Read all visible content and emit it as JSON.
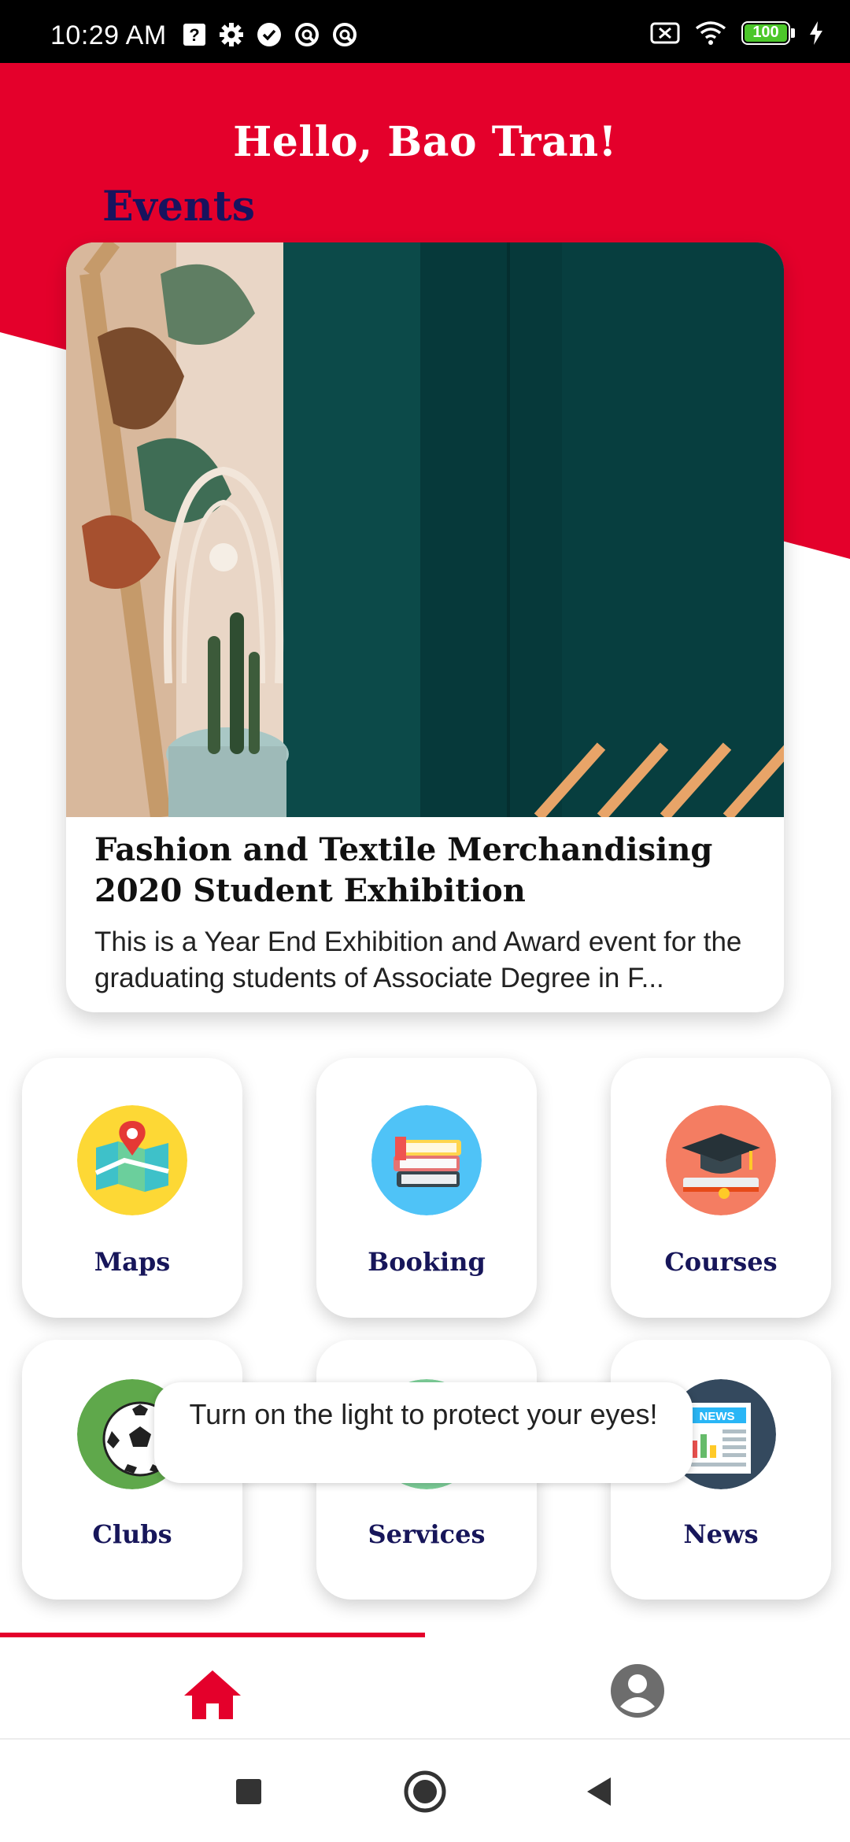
{
  "status_bar": {
    "time": "10:29 AM",
    "battery": "100",
    "icons": [
      "question-icon",
      "settings-icon",
      "check-circle-icon",
      "vpn-icon",
      "vpn-icon",
      "no-sim-icon",
      "wifi-icon",
      "battery-icon",
      "charging-icon"
    ]
  },
  "header": {
    "greeting": "Hello, Bao Tran!",
    "section_title": "Events"
  },
  "event": {
    "title": "Fashion and Textile Merchandising 2020 Student Exhibition",
    "description": "This is a Year End Exhibition and Award event for the graduating students of Associate Degree in F..."
  },
  "tiles": [
    {
      "label": "Maps",
      "icon": "map-icon"
    },
    {
      "label": "Booking",
      "icon": "books-icon"
    },
    {
      "label": "Courses",
      "icon": "graduation-cap-icon"
    },
    {
      "label": "Clubs",
      "icon": "soccer-ball-icon"
    },
    {
      "label": "Services",
      "icon": "services-icon"
    },
    {
      "label": "News",
      "icon": "newspaper-icon"
    }
  ],
  "news_icon_text": "NEWS",
  "toast": {
    "message": "Turn on the light to protect your eyes!"
  },
  "bottom_nav": {
    "items": [
      {
        "name": "home",
        "icon": "home-icon",
        "active": true
      },
      {
        "name": "profile",
        "icon": "account-circle-icon",
        "active": false
      }
    ]
  },
  "colors": {
    "brand_red": "#e4002b",
    "title_navy": "#18135e"
  }
}
